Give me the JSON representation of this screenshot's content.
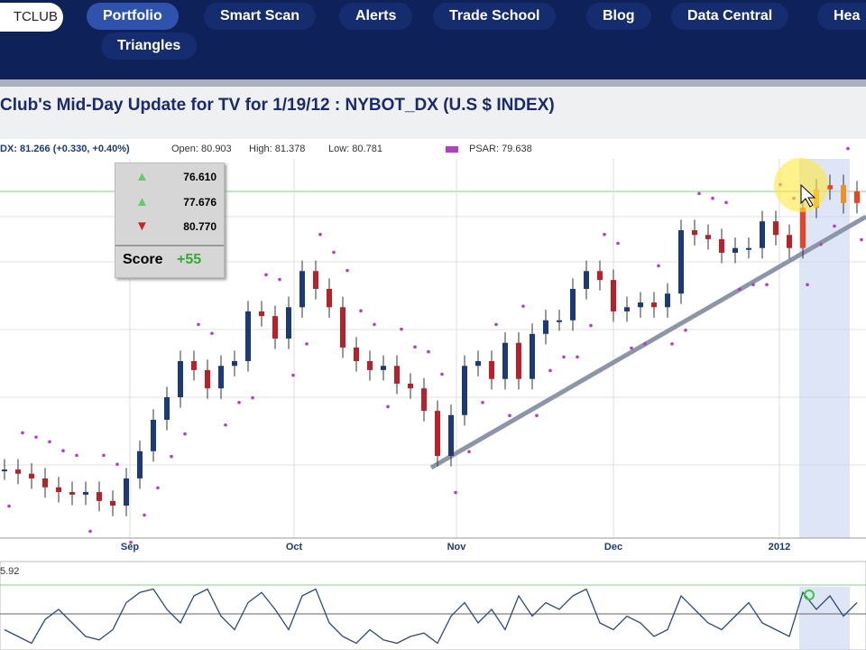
{
  "nav": {
    "logo": "TCLUB",
    "items": [
      "Portfolio",
      "Smart Scan",
      "Alerts",
      "Trade School",
      "Blog",
      "Data Central",
      "Hea"
    ],
    "row2": [
      "Triangles"
    ],
    "active": "Portfolio"
  },
  "title": "Club's Mid-Day  Update for TV  for 1/19/12 : NYBOT_DX (U.S $ INDEX)",
  "legend": {
    "dx": "DX: 81.266 (+0.330, +0.40%)",
    "open": "Open: 80.903",
    "high": "High: 81.378",
    "low": "Low: 80.781",
    "psar": "PSAR: 79.638"
  },
  "triangles": {
    "rows": [
      {
        "icon": "up",
        "value": "76.610"
      },
      {
        "icon": "up",
        "value": "77.676"
      },
      {
        "icon": "down",
        "value": "80.770"
      }
    ],
    "score_label": "Score",
    "score_value": "+55"
  },
  "colors": {
    "up": "#1c3a78",
    "down": "#b8202a",
    "psar": "#b040c0",
    "nav": "#0f2159"
  },
  "chart_data": {
    "type": "candlestick",
    "title": "NYBOT_DX",
    "x_labels": [
      "Sep",
      "Oct",
      "Nov",
      "Dec",
      "2012"
    ],
    "closes": [
      76.04,
      75.96,
      75.87,
      75.7,
      75.61,
      75.56,
      75.61,
      75.44,
      75.35,
      75.87,
      76.39,
      76.99,
      77.42,
      78.11,
      77.94,
      77.59,
      78.02,
      78.11,
      79.06,
      78.97,
      78.54,
      79.14,
      79.83,
      79.49,
      79.14,
      78.37,
      78.11,
      77.94,
      78.02,
      77.68,
      77.59,
      77.16,
      76.3,
      77.08,
      78.02,
      78.11,
      77.77,
      78.46,
      77.77,
      78.63,
      78.89,
      78.89,
      79.49,
      79.83,
      79.66,
      79.06,
      79.14,
      79.23,
      79.14,
      79.4,
      80.61,
      80.52,
      80.44,
      80.18,
      80.27,
      80.27,
      80.78,
      80.52,
      80.27,
      81.04,
      81.39,
      81.47,
      81.13,
      81.35
    ],
    "oscillator_label": "5.92",
    "oscillator": [
      30,
      20,
      10,
      45,
      60,
      40,
      20,
      15,
      30,
      70,
      85,
      90,
      60,
      40,
      80,
      90,
      50,
      30,
      70,
      85,
      60,
      30,
      80,
      90,
      40,
      20,
      10,
      30,
      15,
      10,
      20,
      25,
      10,
      50,
      70,
      40,
      60,
      30,
      80,
      50,
      70,
      60,
      80,
      90,
      40,
      30,
      50,
      40,
      20,
      30,
      80,
      60,
      40,
      30,
      50,
      70,
      40,
      30,
      20,
      85,
      60,
      80,
      50,
      70
    ]
  }
}
